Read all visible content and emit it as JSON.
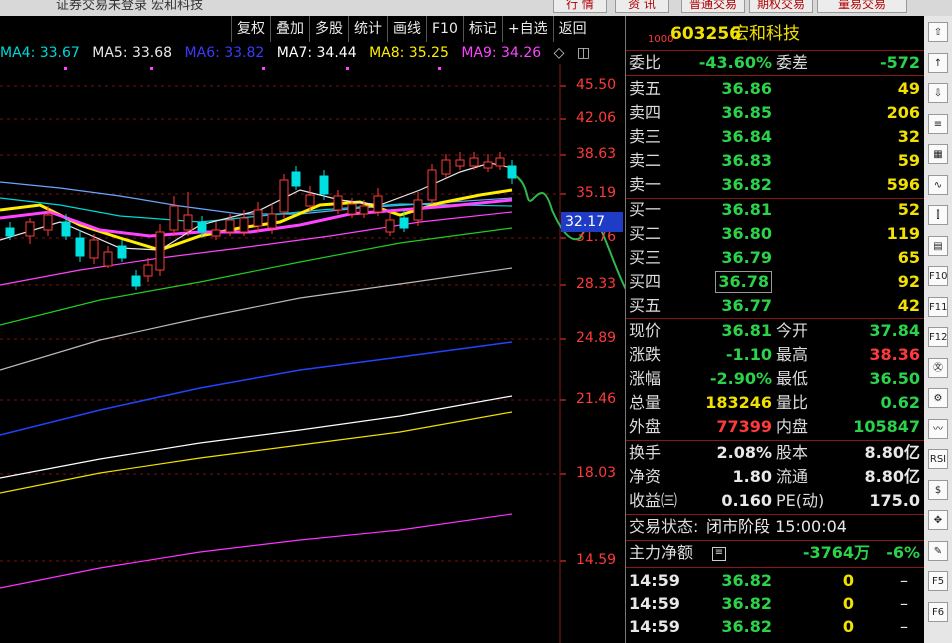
{
  "window": {
    "title": "证券交易未登录  宏和科技",
    "buttons": [
      "行 情",
      "资 讯",
      "普通交易",
      "期权交易",
      "量易交易"
    ]
  },
  "toolbar": {
    "items": [
      "复权",
      "叠加",
      "多股",
      "统计",
      "画线",
      "F10",
      "标记",
      "+自选",
      "返回"
    ]
  },
  "ma_legend": [
    {
      "text": "MA4: 33.67",
      "color": "#00d8d8"
    },
    {
      "text": "MA5: 33.68",
      "color": "#e8e8e8"
    },
    {
      "text": "MA6: 33.82",
      "color": "#3a3aff"
    },
    {
      "text": "MA7: 34.44",
      "color": "#ffffff"
    },
    {
      "text": "MA8: 35.25",
      "color": "#ffee00"
    },
    {
      "text": "MA9: 34.26",
      "color": "#ff44ff"
    }
  ],
  "price_axis": [
    "45.50",
    "42.06",
    "38.63",
    "35.19",
    "31.76",
    "28.33",
    "24.89",
    "21.46",
    "18.03",
    "14.59"
  ],
  "crosshair_value": "32.17",
  "quote": {
    "code_prefix": "1000",
    "code": "603256",
    "name": "宏和科技",
    "weibi_label": "委比",
    "weibi": "-43.60%",
    "weicha_label": "委差",
    "weicha": "-572",
    "sell": [
      {
        "label": "卖五",
        "price": "36.86",
        "volume": "49"
      },
      {
        "label": "卖四",
        "price": "36.85",
        "volume": "206"
      },
      {
        "label": "卖三",
        "price": "36.84",
        "volume": "32"
      },
      {
        "label": "卖二",
        "price": "36.83",
        "volume": "59"
      },
      {
        "label": "卖一",
        "price": "36.82",
        "volume": "596"
      }
    ],
    "buy": [
      {
        "label": "买一",
        "price": "36.81",
        "volume": "52"
      },
      {
        "label": "买二",
        "price": "36.80",
        "volume": "119"
      },
      {
        "label": "买三",
        "price": "36.79",
        "volume": "65"
      },
      {
        "label": "买四",
        "price": "36.78",
        "volume": "92"
      },
      {
        "label": "买五",
        "price": "36.77",
        "volume": "42"
      }
    ],
    "stats": [
      {
        "l1": "现价",
        "v1": "36.81",
        "c1": "green",
        "l2": "今开",
        "v2": "37.84",
        "c2": "green"
      },
      {
        "l1": "涨跌",
        "v1": "-1.10",
        "c1": "green",
        "l2": "最高",
        "v2": "38.36",
        "c2": "red"
      },
      {
        "l1": "涨幅",
        "v1": "-2.90%",
        "c1": "green",
        "l2": "最低",
        "v2": "36.50",
        "c2": "green"
      },
      {
        "l1": "总量",
        "v1": "183246",
        "c1": "yellow",
        "l2": "量比",
        "v2": "0.62",
        "c2": "green"
      },
      {
        "l1": "外盘",
        "v1": "77399",
        "c1": "red",
        "l2": "内盘",
        "v2": "105847",
        "c2": "green"
      }
    ],
    "stats2": [
      {
        "l1": "换手",
        "v1": "2.08%",
        "l2": "股本",
        "v2": "8.80亿"
      },
      {
        "l1": "净资",
        "v1": "1.80",
        "l2": "流通",
        "v2": "8.80亿"
      },
      {
        "l1": "收益㈢",
        "v1": "0.160",
        "l2": "PE(动)",
        "v2": "175.0"
      }
    ],
    "status_label": "交易状态:",
    "status_value": "闭市阶段 15:00:04",
    "mainforce_label": "主力净额",
    "mainforce_value": "-3764万",
    "mainforce_pct": "-6%",
    "ticks": [
      {
        "time": "14:59",
        "price": "36.82",
        "vol": "0",
        "mark": "–"
      },
      {
        "time": "14:59",
        "price": "36.82",
        "vol": "0",
        "mark": "–"
      },
      {
        "time": "14:59",
        "price": "36.82",
        "vol": "0",
        "mark": "–"
      }
    ]
  },
  "rail_icons": [
    {
      "name": "up-icon",
      "glyph": "⇧"
    },
    {
      "name": "arrow-up-icon",
      "glyph": "↑"
    },
    {
      "name": "arrow-down-icon",
      "glyph": "⇩"
    },
    {
      "name": "list-icon",
      "glyph": "≡"
    },
    {
      "name": "table-icon",
      "glyph": "▦"
    },
    {
      "name": "line-chart-icon",
      "glyph": "∿"
    },
    {
      "name": "candle-icon",
      "glyph": "⫿"
    },
    {
      "name": "grid-icon",
      "glyph": "▤"
    },
    {
      "name": "f10-icon",
      "glyph": "F10"
    },
    {
      "name": "f11-icon",
      "glyph": "F11"
    },
    {
      "name": "f12-icon",
      "glyph": "F12"
    },
    {
      "name": "chart-x-icon",
      "glyph": "㉆"
    },
    {
      "name": "gear-icon",
      "glyph": "⚙"
    },
    {
      "name": "wave-icon",
      "glyph": "〰"
    },
    {
      "name": "rsi-icon",
      "glyph": "RSI"
    },
    {
      "name": "dollar-icon",
      "glyph": "$"
    },
    {
      "name": "move-icon",
      "glyph": "✥"
    },
    {
      "name": "pencil-icon",
      "glyph": "✎"
    },
    {
      "name": "f5-icon",
      "glyph": "F5"
    },
    {
      "name": "f6-icon",
      "glyph": "F6"
    }
  ]
}
